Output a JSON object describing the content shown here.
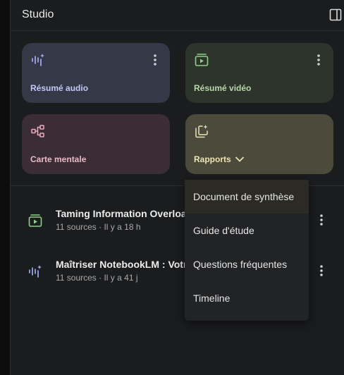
{
  "header": {
    "title": "Studio",
    "panel_icon": "side-panel-icon"
  },
  "tiles": [
    {
      "label": "Résumé audio",
      "icon": "audio-waveform-icon",
      "has_more": true
    },
    {
      "label": "Résumé vidéo",
      "icon": "video-play-icon",
      "has_more": true
    },
    {
      "label": "Carte mentale",
      "icon": "mind-map-icon",
      "has_more": false
    },
    {
      "label": "Rapports",
      "icon": "reports-sparkle-icon",
      "has_dropdown": true
    }
  ],
  "notes": [
    {
      "title": "Taming Information Overload",
      "meta": "11 sources · Il y a 18 h",
      "icon": "video-play-icon"
    },
    {
      "title": "Maîtriser NotebookLM : Votre",
      "meta": "11 sources · Il y a 41 j",
      "icon": "audio-waveform-icon"
    }
  ],
  "dropdown": {
    "items": [
      "Document de synthèse",
      "Guide d'étude",
      "Questions fréquentes",
      "Timeline"
    ]
  },
  "colors": {
    "audio_tile": "#353846",
    "video_tile": "#2d342c",
    "map_tile": "#3a2d33",
    "report_tile": "#4b4a3b",
    "video_accent": "#8fd08a",
    "audio_accent": "#aab4ff",
    "map_accent": "#f0a9c2"
  }
}
